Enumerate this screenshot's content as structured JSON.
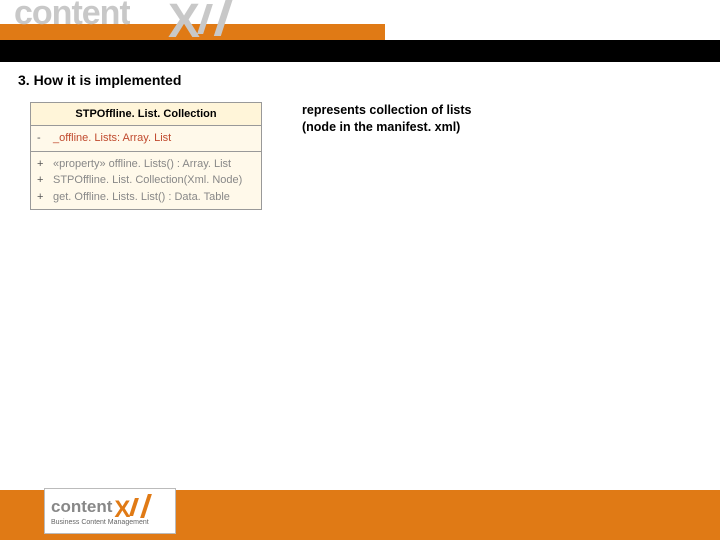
{
  "header": {
    "logo_text": "content",
    "logo_xl": "XL"
  },
  "slide": {
    "title": "3. How it is implemented"
  },
  "uml": {
    "class_name": "STPOffline. List. Collection",
    "attributes": [
      {
        "visibility": "-",
        "signature": "_offline. Lists:  Array. List"
      }
    ],
    "operations": [
      {
        "visibility": "+",
        "signature": "«property» offline. Lists() : Array. List"
      },
      {
        "visibility": "+",
        "signature": "STPOffline. List. Collection(Xml. Node)"
      },
      {
        "visibility": "+",
        "signature": "get. Offline. Lists. List() : Data. Table"
      }
    ]
  },
  "description": {
    "line1": "represents collection of lists",
    "line2": "(node in the manifest. xml)"
  },
  "footer": {
    "logo_content": "content",
    "tagline": "Business Content Management"
  }
}
